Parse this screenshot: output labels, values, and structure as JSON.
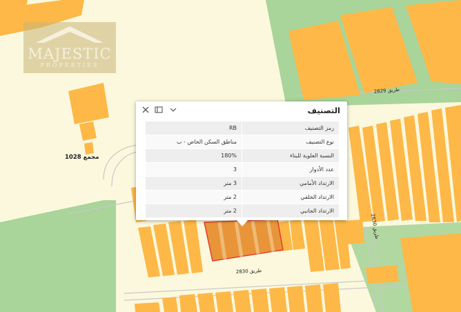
{
  "map": {
    "block_label": "مجمع 1028",
    "roads": [
      {
        "id": "road-2829",
        "label": "طريق 2829"
      },
      {
        "id": "road-2830-vertical",
        "label": "طريق 2830"
      },
      {
        "id": "road-2830-horizontal",
        "label": "طريق 2830"
      }
    ],
    "colors": {
      "background": "#fbf8dd",
      "green_zone": "#a9d49a",
      "parcel": "#fdb847",
      "selected_parcel": "#e8953a",
      "selected_outline": "#e53b2c",
      "road_line": "#c8c8c8"
    }
  },
  "logo": {
    "brand": "MAJESTIC",
    "tagline": "PROPERTIES"
  },
  "popup": {
    "title": "التصنيف",
    "icons": [
      "close-icon",
      "dock-icon",
      "chevron-down-icon"
    ],
    "fields": [
      {
        "key": "رمز التصنيف",
        "value": "RB"
      },
      {
        "key": "نوع التصنيف",
        "value": "مناطق السكن الخاص - ب"
      },
      {
        "key": "النسبة العلوية للبناء",
        "value": "180%"
      },
      {
        "key": "عدد الأدوار",
        "value": "3"
      },
      {
        "key": "الارتداد الأمامي",
        "value": "3 متر"
      },
      {
        "key": "الارتداد الخلفي",
        "value": "2 متر"
      },
      {
        "key": "الارتداد الجانبي",
        "value": "2 متر"
      }
    ]
  }
}
